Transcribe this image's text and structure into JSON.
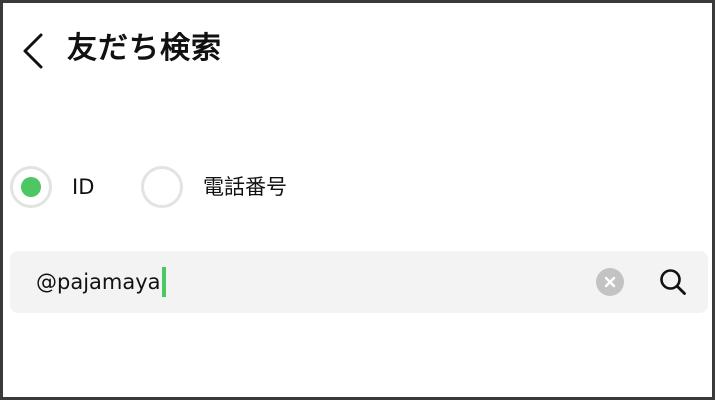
{
  "header": {
    "back_icon": "chevron-left-icon",
    "title": "友だち検索"
  },
  "search_type": {
    "selected": "ID",
    "options": [
      {
        "label": "ID",
        "selected": true
      },
      {
        "label": "電話番号",
        "selected": false
      }
    ]
  },
  "search": {
    "value": "@pajamaya",
    "clear_icon": "clear-icon",
    "search_icon": "search-icon"
  },
  "colors": {
    "accent": "#4cc764",
    "field_background": "#f3f3f3",
    "radio_border": "#e3e3e3",
    "clear_button": "#c3c3c3",
    "text": "#111111"
  }
}
